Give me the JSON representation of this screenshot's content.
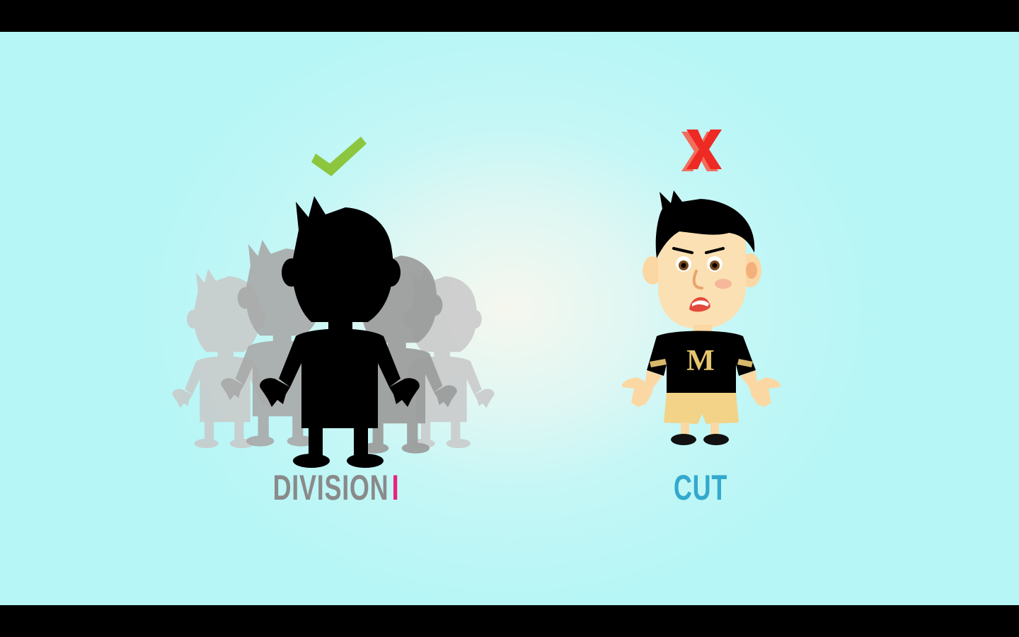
{
  "left_panel": {
    "label_word": "DIVISION",
    "label_numeral": "I",
    "label_color": "#8a8a8a",
    "numeral_color": "#ec1f7b",
    "mark_icon": "check-icon",
    "mark_color": "#8cc63f"
  },
  "right_panel": {
    "label": "CUT",
    "label_color": "#33a9cc",
    "mark_icon": "x-icon",
    "mark_color": "#ee2a24",
    "shirt_letter": "M"
  },
  "colors": {
    "background_center": "#f6f7ef",
    "background_edge": "#b7f6f6",
    "letterbox": "#000000"
  }
}
